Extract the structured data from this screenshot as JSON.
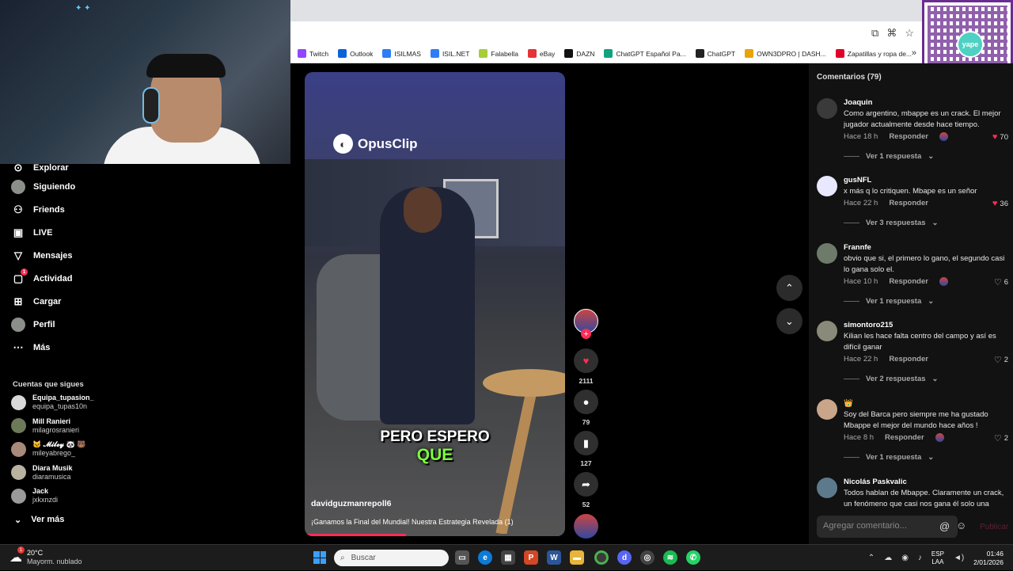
{
  "bookmarks": [
    {
      "label": "Twitch",
      "color": "#9146ff"
    },
    {
      "label": "Outlook",
      "color": "#0a64d8"
    },
    {
      "label": "ISILMAS",
      "color": "#2d7df6"
    },
    {
      "label": "ISIL.NET",
      "color": "#2d7df6"
    },
    {
      "label": "Falabella",
      "color": "#a6ce39"
    },
    {
      "label": "eBay",
      "color": "#e53238"
    },
    {
      "label": "DAZN",
      "color": "#111111"
    },
    {
      "label": "ChatGPT Español Pa...",
      "color": "#10a37f"
    },
    {
      "label": "ChatGPT",
      "color": "#222222"
    },
    {
      "label": "OWN3DPRO | DASH...",
      "color": "#e8a400"
    },
    {
      "label": "Zapatillas y ropa de...",
      "color": "#e0002a"
    }
  ],
  "bookmarks_more": "»",
  "qr": {
    "logo_text": "yape"
  },
  "nav": [
    {
      "label": "Explorar",
      "icon": "compass-icon"
    },
    {
      "label": "Siguiendo",
      "icon": "avatar-icon"
    },
    {
      "label": "Friends",
      "icon": "friends-icon"
    },
    {
      "label": "LIVE",
      "icon": "live-icon"
    },
    {
      "label": "Mensajes",
      "icon": "send-icon"
    },
    {
      "label": "Actividad",
      "icon": "activity-icon",
      "badge": "1"
    },
    {
      "label": "Cargar",
      "icon": "upload-icon"
    },
    {
      "label": "Perfil",
      "icon": "profile-icon"
    },
    {
      "label": "Más",
      "icon": "ellipsis-icon"
    }
  ],
  "following": {
    "heading": "Cuentas que sigues",
    "accounts": [
      {
        "name": "Equipa_tupasion_",
        "handle": "equipa_tupas10n"
      },
      {
        "name": "Mill Ranieri",
        "handle": "milagrosranieri"
      },
      {
        "name": "🐱 𝓜𝓲𝓵𝓮𝔂 🐼 🐻",
        "handle": "mileyabrego_"
      },
      {
        "name": "Diara Musik",
        "handle": "diaramusica"
      },
      {
        "name": "Jack",
        "handle": "jxkxnzdi"
      }
    ],
    "more_label": "Ver más"
  },
  "video": {
    "watermark": "OpusClip",
    "caption_line1": "PERO ESPERO",
    "caption_line2": "QUE",
    "author": "davidguzmanrepoll6",
    "description": "¡Ganamos la Final del Mundial! Nuestra Estrategia Revelada (1)",
    "progress": 0.39
  },
  "actions": {
    "likes": "2111",
    "comments": "79",
    "saves": "127",
    "shares": "52"
  },
  "comments": {
    "title": "Comentarios (79)",
    "reply_label": "Responder",
    "items": [
      {
        "user": "Joaquin",
        "text": "Como argentino, mbappe es un crack. El mejor jugador actualmente desde hace tiempo.",
        "time": "Hace 18 h",
        "likes": "70",
        "liked": true,
        "creator_liked": true,
        "view": "Ver 1 respuesta"
      },
      {
        "user": "gusNFL",
        "text": "x más q lo critiquen. Mbape es un señor",
        "time": "Hace 22 h",
        "likes": "36",
        "liked": true,
        "creator_liked": false,
        "view": "Ver 3 respuestas"
      },
      {
        "user": "Frannfe",
        "text": "obvio que si, el primero lo gano, el segundo casi lo gana solo el.",
        "time": "Hace 10 h",
        "likes": "6",
        "liked": false,
        "creator_liked": true,
        "view": "Ver 1 respuesta"
      },
      {
        "user": "simontoro215",
        "text": "Kilian les hace falta centro del campo y así es difícil ganar",
        "time": "Hace 22 h",
        "likes": "2",
        "liked": false,
        "creator_liked": false,
        "view": "Ver 2 respuestas"
      },
      {
        "user": "👑",
        "text": "Soy del Barca pero siempre me ha gustado Mbappe el mejor del mundo hace años !",
        "time": "Hace 8 h",
        "likes": "2",
        "liked": false,
        "creator_liked": true,
        "view": "Ver 1 respuesta"
      },
      {
        "user": "Nicolás Paskvalic",
        "text": "Todos hablan de Mbappe. Claramente un crack, un fenómeno que casi nos gana él solo una",
        "time": "",
        "likes": "",
        "liked": false,
        "creator_liked": false,
        "view": ""
      }
    ],
    "input_placeholder": "Agregar comentario...",
    "post_label": "Publicar"
  },
  "taskbar": {
    "weather_temp": "20°C",
    "weather_desc": "Mayorm. nublado",
    "weather_badge": "1",
    "search_placeholder": "Buscar",
    "lang1": "ESP",
    "lang2": "LAA",
    "time": "01:46",
    "date": "2/01/2026"
  }
}
